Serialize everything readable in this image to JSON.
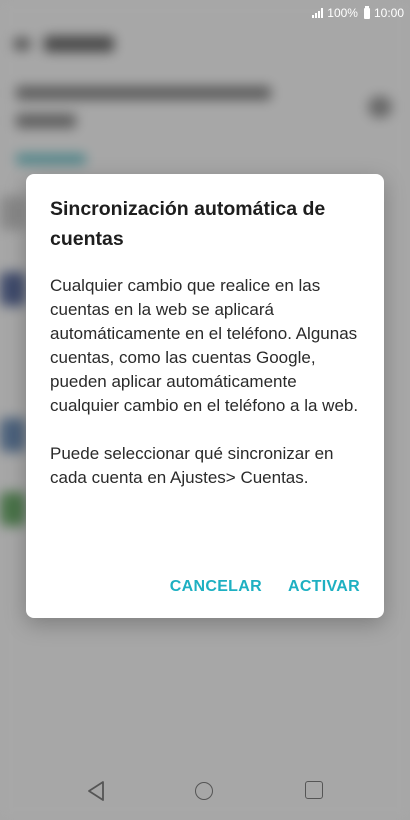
{
  "status_bar": {
    "battery": "100%",
    "time": "10:00"
  },
  "dialog": {
    "title": "Sincronización automática de cuentas",
    "paragraphs": [
      "Cualquier cambio que realice en las cuentas en la web se aplicará automáticamente en el teléfono. Algunas cuentas, como las cuentas Google, pueden aplicar automáticamente cualquier cambio en el teléfono a la web.",
      "Puede seleccionar qué sincronizar en cada cuenta en Ajustes> Cuentas."
    ],
    "cancel_label": "CANCELAR",
    "confirm_label": "ACTIVAR"
  },
  "colors": {
    "accent": "#1eb0c2"
  },
  "nav": {
    "icons": [
      "back-icon",
      "home-icon",
      "recents-icon"
    ]
  }
}
